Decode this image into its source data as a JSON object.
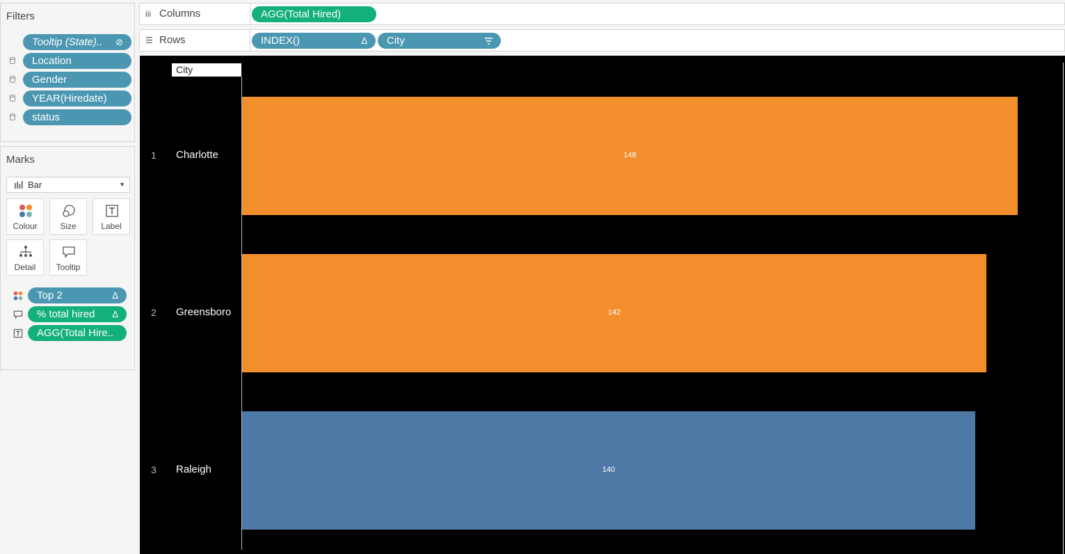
{
  "filters": {
    "title": "Filters",
    "items": [
      {
        "label": "Tooltip (State)..",
        "italic": true,
        "suffix_icon": "link-icon"
      },
      {
        "label": "Location"
      },
      {
        "label": "Gender"
      },
      {
        "label": "YEAR(Hiredate)"
      },
      {
        "label": "status"
      }
    ]
  },
  "marks": {
    "title": "Marks",
    "mark_type": "Bar",
    "mark_type_icon": "bar-chart-icon",
    "buttons": [
      {
        "label": "Colour",
        "icon": "colour-icon"
      },
      {
        "label": "Size",
        "icon": "size-icon"
      },
      {
        "label": "Label",
        "icon": "label-icon"
      },
      {
        "label": "Detail",
        "icon": "detail-icon"
      },
      {
        "label": "Tooltip",
        "icon": "tooltip-icon"
      }
    ],
    "cards": [
      {
        "label": "Top 2",
        "icon": "colour-icon",
        "suffix": "Δ",
        "color": "#4b97b2"
      },
      {
        "label": "% total hired",
        "icon": "tooltip-icon",
        "suffix": "Δ",
        "color": "#14b07a"
      },
      {
        "label": "AGG(Total Hire..",
        "icon": "label-icon",
        "suffix": "",
        "color": "#14b07a"
      }
    ]
  },
  "columns": {
    "label": "Columns",
    "icon": "columns-icon",
    "pills": [
      {
        "label": "AGG(Total Hired)",
        "color": "#14b07a"
      }
    ]
  },
  "rows": {
    "label": "Rows",
    "icon": "rows-icon",
    "pills": [
      {
        "label": "INDEX()",
        "suffix": "Δ",
        "color": "#4b97b2"
      },
      {
        "label": "City",
        "suffix": "sort-icon",
        "color": "#4b97b2"
      }
    ]
  },
  "view": {
    "header": "City",
    "background": "#000000"
  },
  "chart_data": {
    "type": "bar",
    "orientation": "horizontal",
    "categories": [
      "Charlotte",
      "Greensboro",
      "Raleigh"
    ],
    "row_index": [
      "1",
      "2",
      "3"
    ],
    "values": [
      148,
      142,
      140
    ],
    "data_labels": [
      "148",
      "142",
      "140"
    ],
    "bar_colors": [
      "#f28e2b",
      "#f28e2b",
      "#4e79a7"
    ],
    "title": "",
    "xlabel": "",
    "ylabel": "City",
    "xlim": [
      0,
      156
    ],
    "grid": false
  }
}
